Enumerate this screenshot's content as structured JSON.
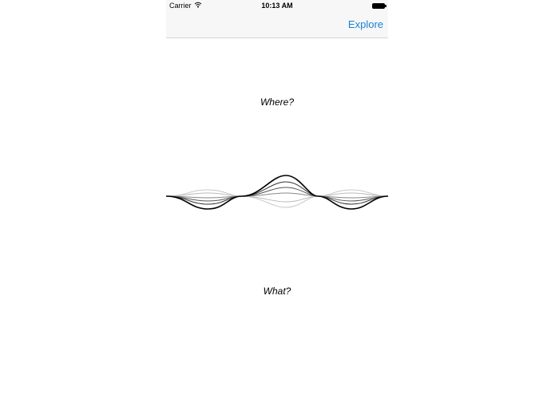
{
  "status_bar": {
    "carrier": "Carrier",
    "time": "10:13 AM",
    "icons": [
      "wifi-icon",
      "battery-icon"
    ]
  },
  "nav": {
    "explore_label": "Explore"
  },
  "prompts": {
    "where": "Where?",
    "what": "What?"
  },
  "colors": {
    "accent": "#1a82d6",
    "bar_background": "#f7f7f7"
  }
}
